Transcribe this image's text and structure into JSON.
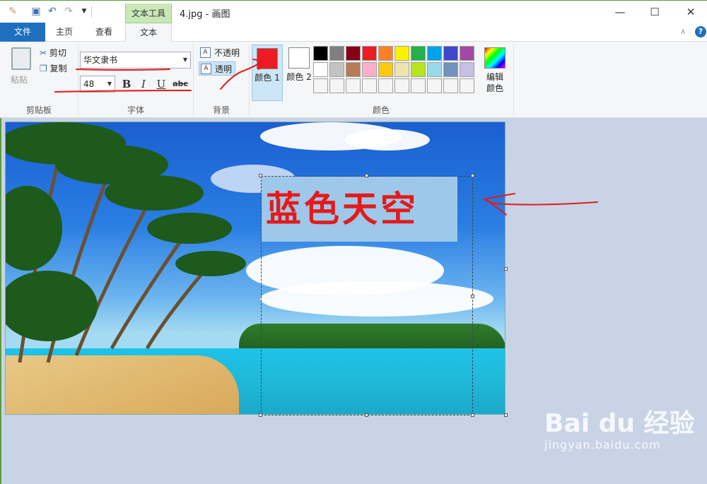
{
  "titlebar": {
    "context_tab": "文本工具",
    "title": "4.jpg - 画图",
    "minimize": "—",
    "maximize": "☐",
    "close": "✕"
  },
  "tabs": {
    "file": "文件",
    "home": "主页",
    "view": "查看",
    "text": "文本"
  },
  "help": {
    "collapse": "∧",
    "help_icon": "?"
  },
  "clipboard": {
    "group_label": "剪贴板",
    "paste": "粘贴",
    "cut": "剪切",
    "copy": "复制"
  },
  "font": {
    "group_label": "字体",
    "family": "华文隶书",
    "size": "48",
    "bold": "B",
    "italic": "I",
    "underline": "U",
    "strike": "abc"
  },
  "background": {
    "group_label": "背景",
    "opaque": "不透明",
    "transparent": "透明",
    "selected": "transparent"
  },
  "colors": {
    "group_label": "颜色",
    "color1_label": "颜色 1",
    "color2_label": "颜色 2",
    "color1": "#ed1c24",
    "color2": "#ffffff",
    "edit_label": "编辑颜色",
    "palette": [
      "#000000",
      "#7f7f7f",
      "#880015",
      "#ed1c24",
      "#ff7f27",
      "#fff200",
      "#22b14c",
      "#00a2e8",
      "#3f48cc",
      "#a349a4",
      "#ffffff",
      "#c3c3c3",
      "#b97a57",
      "#ffaec9",
      "#ffc90e",
      "#efe4b0",
      "#b5e61d",
      "#99d9ea",
      "#7092be",
      "#c8bfe7",
      "#f5f5f5",
      "#f5f5f5",
      "#f5f5f5",
      "#f5f5f5",
      "#f5f5f5",
      "#f5f5f5",
      "#f5f5f5",
      "#f5f5f5",
      "#f5f5f5",
      "#f5f5f5"
    ]
  },
  "canvas": {
    "text": "蓝色天空"
  },
  "watermark": {
    "brand": "Bai du 经验",
    "url": "jingyan.baidu.com"
  },
  "annotations": {
    "color": "#e41a1a"
  }
}
